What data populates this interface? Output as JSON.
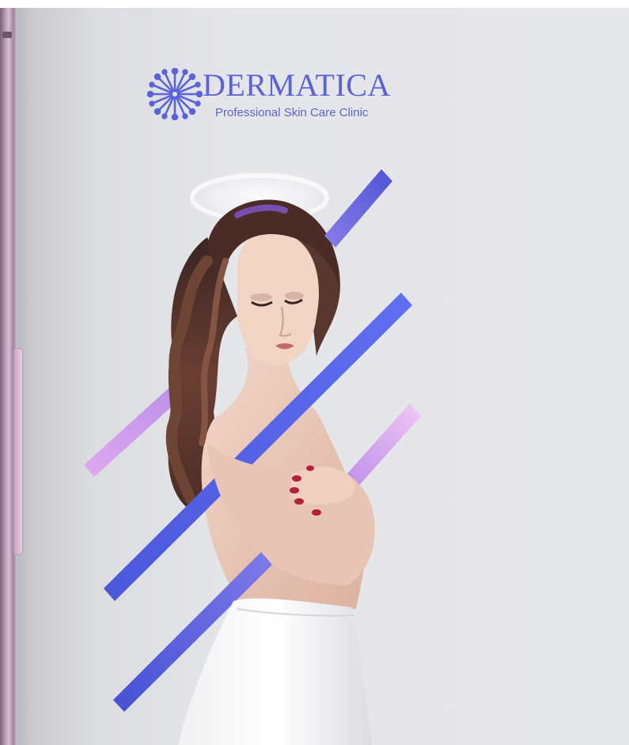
{
  "brand": {
    "name": "DERMATICA",
    "tagline": "Professional Skin Care Clinic",
    "logo_icon": "snowflake-burst-icon"
  },
  "hero": {
    "subject": "hero-image-woman"
  },
  "colors": {
    "brand_blue": "#5a63d9",
    "stripe_blue": "#4d5ee6",
    "stripe_lilac": "#d9a8ee",
    "background": "#e4e5e8"
  }
}
